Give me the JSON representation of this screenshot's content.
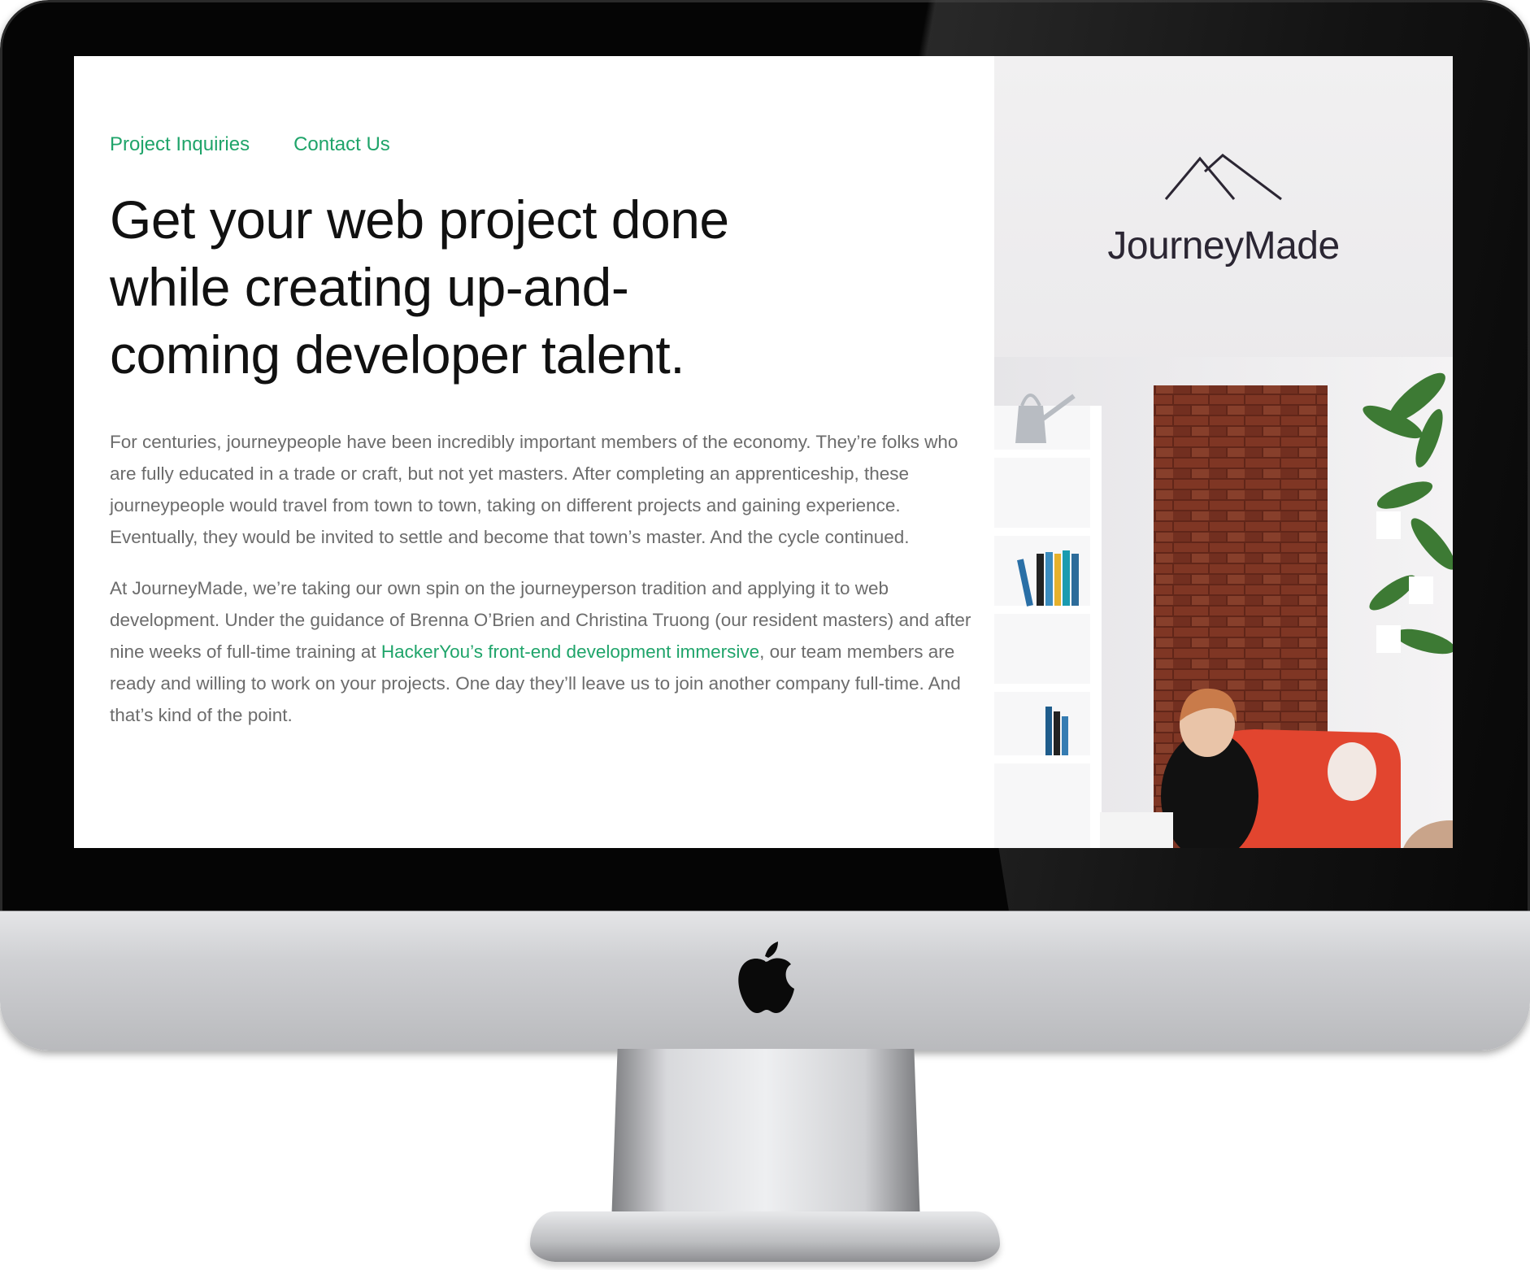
{
  "nav": {
    "items": [
      "Project Inquiries",
      "Contact Us"
    ]
  },
  "hero": {
    "headline_line1": "Get your web project done",
    "headline_line2": "while creating up-and-",
    "headline_line3": "coming developer talent."
  },
  "body": {
    "paragraph1": "For centuries, journeypeople have been incredibly important members of the economy. They’re folks who are fully educated in a trade or craft, but not yet masters. After completing an apprenticeship, these journeypeople would travel from town to town, taking on different projects and gaining experience. Eventually, they would be invited to settle and become that town’s master. And the cycle continued.",
    "paragraph2_before": "At JourneyMade, we’re taking our own spin on the journeyperson tradition and applying it to web development. Under the guidance of Brenna O’Brien and Christina Truong (our resident masters) and after nine weeks of full-time training at ",
    "paragraph2_link": "HackerYou’s front-end development immersive",
    "paragraph2_after": ", our team members are ready and willing to work on your projects. One day they’ll leave us to join another company full-time. And that’s kind of the point."
  },
  "brand": {
    "name": "JourneyMade",
    "mark_icon": "mountain-peaks-icon"
  },
  "device": {
    "logo_icon": "apple-logo-icon"
  },
  "colors": {
    "accent": "#1fa46a",
    "headline": "#111111",
    "body_text": "#6c6c6c",
    "brand_text": "#2b2633",
    "brick": "#8a3b28",
    "chair": "#e2452f"
  }
}
